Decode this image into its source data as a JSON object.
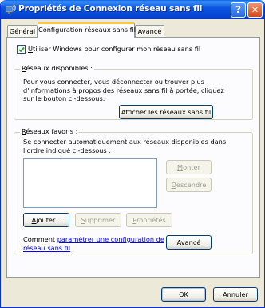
{
  "window": {
    "title": "Propriétés de Connexion réseau sans fil",
    "help_glyph": "?",
    "close_glyph": "✕"
  },
  "tabs": [
    {
      "label": "Général",
      "active": false
    },
    {
      "label": "Configuration réseaux sans fil",
      "active": true
    },
    {
      "label": "Avancé",
      "active": false
    }
  ],
  "use_windows": {
    "checked": true,
    "pre": "",
    "key": "U",
    "post": "tiliser Windows pour configurer mon réseau sans fil"
  },
  "available": {
    "legend_key": "R",
    "legend_rest": "éseaux disponibles :",
    "lines": [
      "Pour vous connecter, vous déconnecter ou trouver plus",
      "d'informations à propos des réseaux sans fil à portée, cliquez",
      "sur le bouton ci-dessous."
    ],
    "show_button": "Afficher les réseaux sans fil"
  },
  "preferred": {
    "legend_key": "R",
    "legend_rest": "éseaux favoris :",
    "lines": [
      "Se connecter automatiquement aux réseaux disponibles dans",
      "l'ordre indiqué ci-dessous :"
    ],
    "up_button": {
      "key": "M",
      "rest": "onter"
    },
    "down_button": {
      "key": "D",
      "rest": "escendre"
    },
    "add_button": {
      "key": "A",
      "rest": "jouter..."
    },
    "remove_button": {
      "key": "S",
      "rest": "upprimer"
    },
    "props_button": {
      "key": "P",
      "rest": "ropriétés"
    },
    "learn_prefix": "Comment ",
    "learn_link_line1": "paramétrer une configuration de",
    "learn_link_line2": "réseau sans fil",
    "learn_suffix": ".",
    "advanced_button": {
      "pre": "A",
      "key": "v",
      "rest": "ancé"
    }
  },
  "footer": {
    "ok": "OK",
    "cancel": "Annuler"
  }
}
